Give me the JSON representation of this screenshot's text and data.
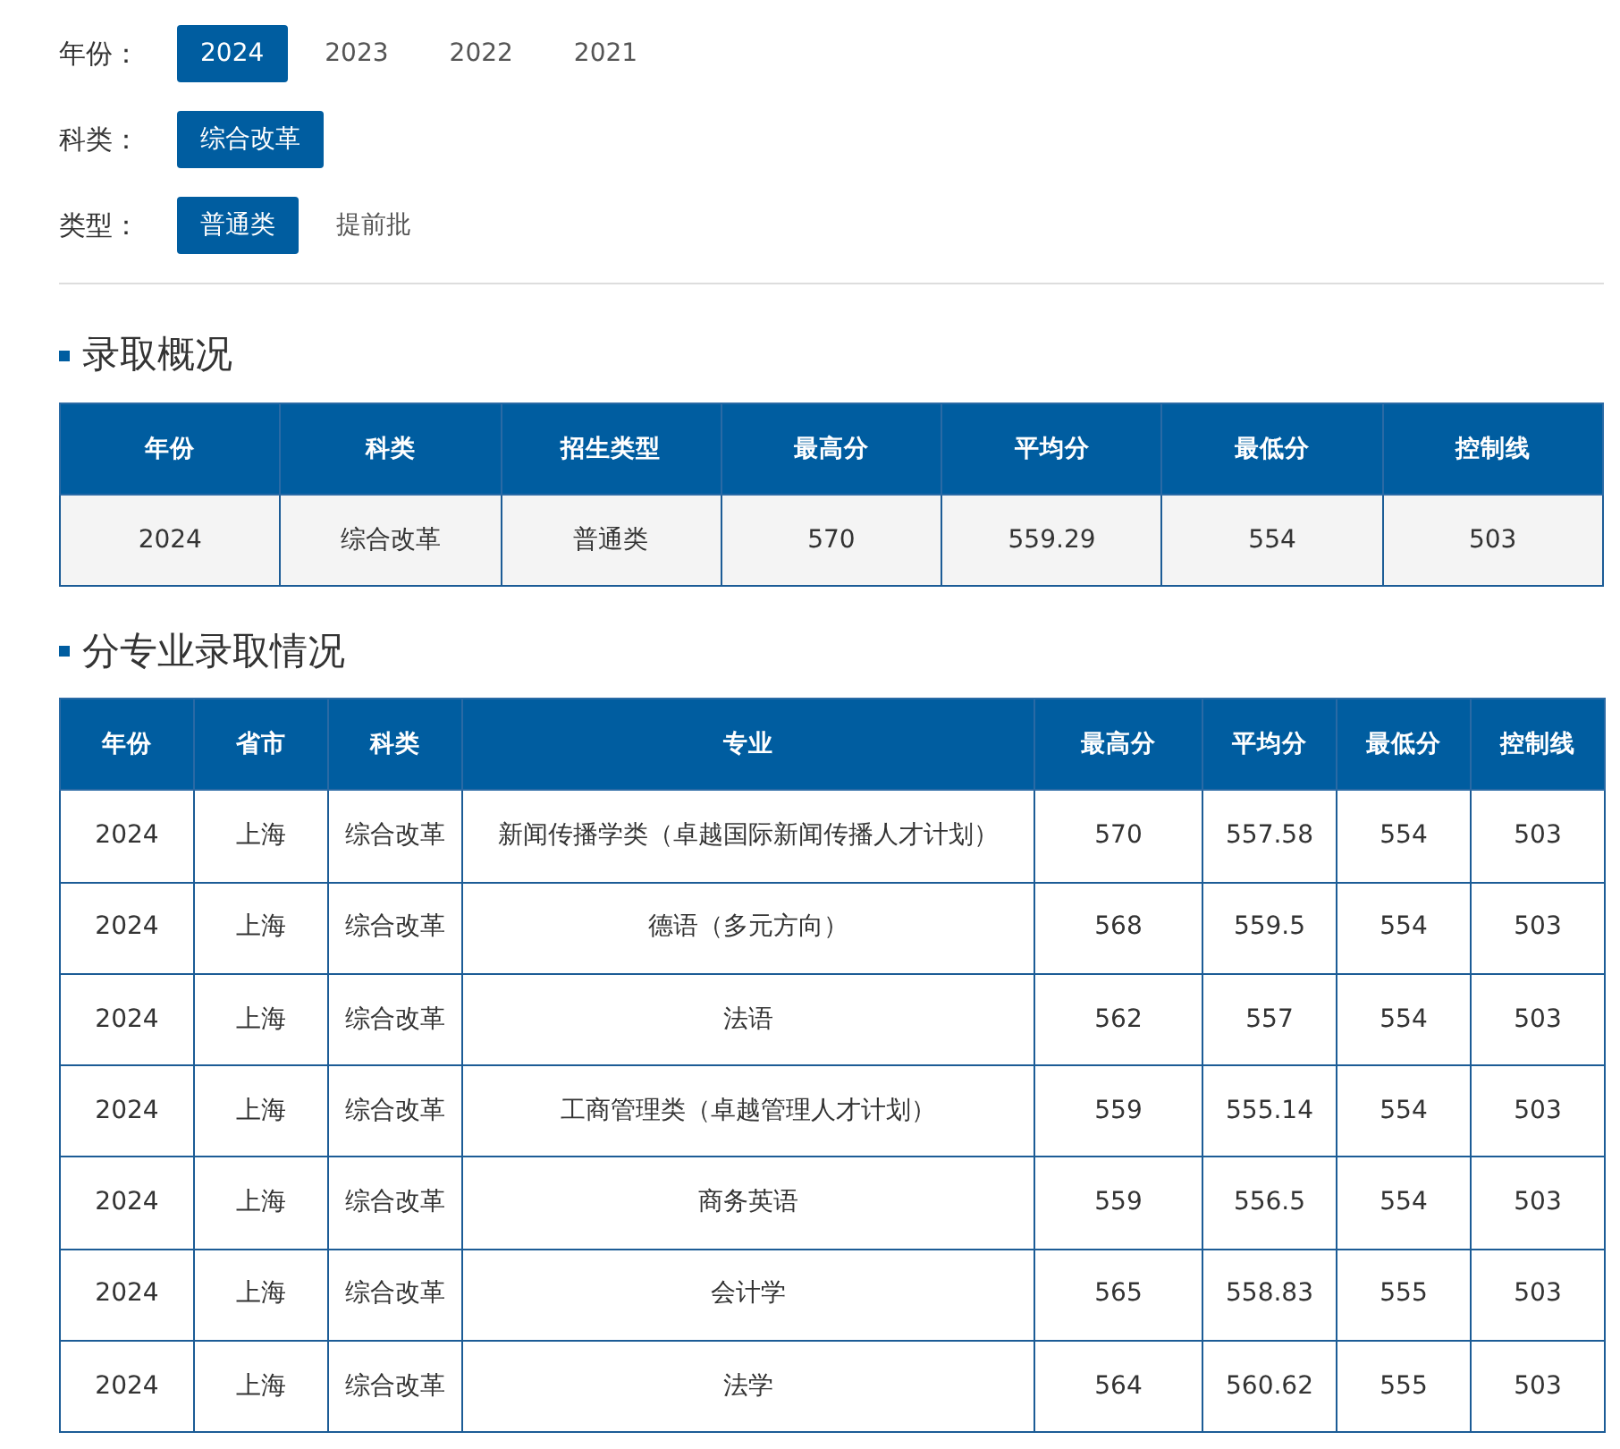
{
  "filters": [
    {
      "label": "年份：",
      "options": [
        {
          "text": "2024",
          "selected": true
        },
        {
          "text": "2023",
          "selected": false
        },
        {
          "text": "2022",
          "selected": false
        },
        {
          "text": "2021",
          "selected": false
        }
      ]
    },
    {
      "label": "科类：",
      "options": [
        {
          "text": "综合改革",
          "selected": true
        }
      ]
    },
    {
      "label": "类型：",
      "options": [
        {
          "text": "普通类",
          "selected": true
        },
        {
          "text": "提前批",
          "selected": false
        }
      ]
    }
  ],
  "overview": {
    "title": "录取概况",
    "columns": [
      "年份",
      "科类",
      "招生类型",
      "最高分",
      "平均分",
      "最低分",
      "控制线"
    ],
    "rows": [
      [
        "2024",
        "综合改革",
        "普通类",
        "570",
        "559.29",
        "554",
        "503"
      ]
    ]
  },
  "majors": {
    "title": "分专业录取情况",
    "columns": [
      "年份",
      "省市",
      "科类",
      "专业",
      "最高分",
      "平均分",
      "最低分",
      "控制线"
    ],
    "rows": [
      [
        "2024",
        "上海",
        "综合改革",
        "新闻传播学类（卓越国际新闻传播人才计划）",
        "570",
        "557.58",
        "554",
        "503"
      ],
      [
        "2024",
        "上海",
        "综合改革",
        "德语（多元方向）",
        "568",
        "559.5",
        "554",
        "503"
      ],
      [
        "2024",
        "上海",
        "综合改革",
        "法语",
        "562",
        "557",
        "554",
        "503"
      ],
      [
        "2024",
        "上海",
        "综合改革",
        "工商管理类（卓越管理人才计划）",
        "559",
        "555.14",
        "554",
        "503"
      ],
      [
        "2024",
        "上海",
        "综合改革",
        "商务英语",
        "559",
        "556.5",
        "554",
        "503"
      ],
      [
        "2024",
        "上海",
        "综合改革",
        "会计学",
        "565",
        "558.83",
        "555",
        "503"
      ],
      [
        "2024",
        "上海",
        "综合改革",
        "法学",
        "564",
        "560.62",
        "555",
        "503"
      ]
    ]
  }
}
